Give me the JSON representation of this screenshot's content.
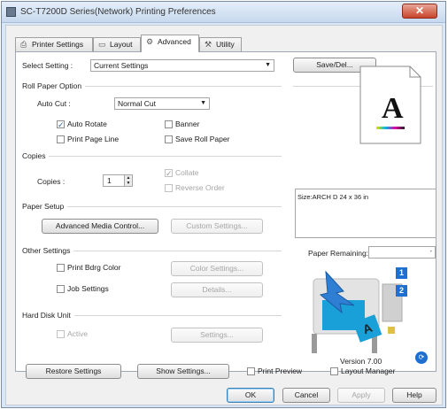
{
  "window": {
    "title": "SC-T7200D Series(Network) Printing Preferences",
    "close_glyph": "✕"
  },
  "tabs": [
    {
      "label": "Printer Settings",
      "icon": "printer-icon"
    },
    {
      "label": "Layout",
      "icon": "layout-icon"
    },
    {
      "label": "Advanced",
      "icon": "gear-icon"
    },
    {
      "label": "Utility",
      "icon": "wrench-icon"
    }
  ],
  "select_setting": {
    "label": "Select Setting :",
    "value": "Current Settings",
    "save_del": "Save/Del..."
  },
  "roll_paper": {
    "title": "Roll Paper Option",
    "auto_cut_label": "Auto Cut :",
    "auto_cut_value": "Normal Cut",
    "auto_rotate": {
      "label": "Auto Rotate",
      "checked": true
    },
    "banner": {
      "label": "Banner",
      "checked": false
    },
    "print_page_line": {
      "label": "Print Page Line",
      "checked": false
    },
    "save_roll_paper": {
      "label": "Save Roll Paper",
      "checked": false
    }
  },
  "copies": {
    "title": "Copies",
    "copies_label": "Copies :",
    "copies_value": "1",
    "collate": {
      "label": "Collate",
      "checked": true
    },
    "reverse_order": {
      "label": "Reverse Order",
      "checked": false
    }
  },
  "paper_setup": {
    "title": "Paper Setup",
    "advanced_media": "Advanced Media Control...",
    "custom_settings": "Custom Settings..."
  },
  "other_settings": {
    "title": "Other Settings",
    "print_bdrg_color": {
      "label": "Print Bdrg Color",
      "checked": false
    },
    "color_settings": "Color Settings...",
    "job_settings": {
      "label": "Job Settings",
      "checked": false
    },
    "details": "Details..."
  },
  "hard_disk": {
    "title": "Hard Disk Unit",
    "active": {
      "label": "Active",
      "checked": false
    },
    "settings": "Settings..."
  },
  "preview": {
    "letter": "A"
  },
  "info": {
    "text": "Size:ARCH D 24 x 36 in"
  },
  "paper_remaining": {
    "label": "Paper Remaining:"
  },
  "printer_badges": [
    "1",
    "2"
  ],
  "version": "Version 7.00",
  "bottom_bar": {
    "restore": "Restore Settings",
    "show": "Show Settings...",
    "print_preview": {
      "label": "Print Preview",
      "checked": false
    },
    "layout_manager": {
      "label": "Layout Manager",
      "checked": false
    }
  },
  "dialog_buttons": {
    "ok": "OK",
    "cancel": "Cancel",
    "apply": "Apply",
    "help": "Help"
  },
  "colors": {
    "accent_blue": "#1f6fd1",
    "close_red": "#c8432a"
  }
}
